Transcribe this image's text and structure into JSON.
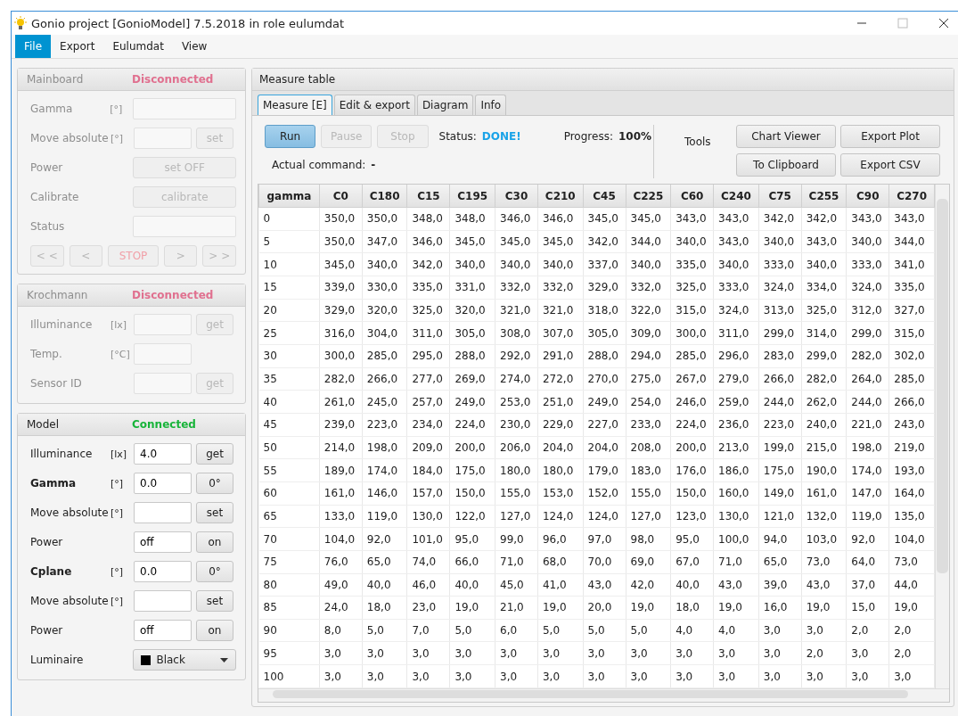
{
  "window": {
    "title": "Gonio project [GonioModel] 7.5.2018 in role eulumdat"
  },
  "menu": [
    {
      "label": "File",
      "selected": true
    },
    {
      "label": "Export",
      "selected": false
    },
    {
      "label": "Eulumdat",
      "selected": false
    },
    {
      "label": "View",
      "selected": false
    }
  ],
  "panels": [
    {
      "title": "Mainboard",
      "status": "Disconnected",
      "connected": false,
      "rows": [
        {
          "kind": "wide_field",
          "label": "Gamma",
          "bold": false,
          "unit": "[°]",
          "value": ""
        },
        {
          "kind": "field_button",
          "label": "Move absolute",
          "bold": false,
          "unit": "[°]",
          "value": "",
          "button": "set"
        },
        {
          "kind": "wide_button",
          "label": "Power",
          "bold": false,
          "button": "set OFF"
        },
        {
          "kind": "wide_button",
          "label": "Calibrate",
          "bold": false,
          "button": "calibrate"
        },
        {
          "kind": "wide_field",
          "label": "Status",
          "bold": false,
          "value": ""
        }
      ],
      "nav_buttons": [
        {
          "label": "< <",
          "kind": "normal"
        },
        {
          "label": "<",
          "kind": "normal"
        },
        {
          "label": "STOP",
          "kind": "stop"
        },
        {
          "label": ">",
          "kind": "normal"
        },
        {
          "label": "> >",
          "kind": "normal"
        }
      ]
    },
    {
      "title": "Krochmann",
      "status": "Disconnected",
      "connected": false,
      "rows": [
        {
          "kind": "field_button",
          "label": "Illuminance",
          "bold": false,
          "unit": "[lx]",
          "value": "",
          "button": "get"
        },
        {
          "kind": "field",
          "label": "Temp.",
          "bold": false,
          "unit": "[°C]",
          "value": ""
        },
        {
          "kind": "field_button",
          "label": "Sensor ID",
          "bold": false,
          "value": "",
          "button": "get"
        }
      ]
    },
    {
      "title": "Model",
      "status": "Connected",
      "connected": true,
      "rows": [
        {
          "kind": "field_button",
          "label": "Illuminance",
          "bold": false,
          "unit": "[lx]",
          "value": "4.0",
          "button": "get"
        },
        {
          "kind": "field_button",
          "label": "Gamma",
          "bold": true,
          "unit": "[°]",
          "value": "0.0",
          "button": "0°"
        },
        {
          "kind": "field_button",
          "label": "Move absolute",
          "bold": false,
          "unit": "[°]",
          "value": "",
          "button": "set"
        },
        {
          "kind": "field_button",
          "label": "Power",
          "bold": false,
          "value": "off",
          "button": "on"
        },
        {
          "kind": "field_button",
          "label": "Cplane",
          "bold": true,
          "unit": "[°]",
          "value": "0.0",
          "button": "0°"
        },
        {
          "kind": "field_button",
          "label": "Move absolute",
          "bold": false,
          "unit": "[°]",
          "value": "",
          "button": "set"
        },
        {
          "kind": "field_button",
          "label": "Power",
          "bold": false,
          "value": "off",
          "button": "on"
        },
        {
          "kind": "select",
          "label": "Luminaire",
          "bold": false,
          "value": "Black",
          "color": "#000000"
        }
      ]
    }
  ],
  "measure": {
    "title": "Measure table",
    "tabs": [
      {
        "label": "Measure [E]",
        "selected": true
      },
      {
        "label": "Edit & export",
        "selected": false
      },
      {
        "label": "Diagram",
        "selected": false
      },
      {
        "label": "Info",
        "selected": false
      }
    ],
    "controls": [
      {
        "label": "Run",
        "disabled": false
      },
      {
        "label": "Pause",
        "disabled": true
      },
      {
        "label": "Stop",
        "disabled": true
      }
    ],
    "status_label": "Status:",
    "status": "DONE!",
    "progress_label": "Progress:",
    "progress": "100%",
    "command_label": "Actual command:",
    "command": "-",
    "tools_label": "Tools",
    "tools": [
      "Chart Viewer",
      "Export Plot",
      "To Clipboard",
      "Export CSV"
    ],
    "columns": [
      "gamma",
      "C0",
      "C180",
      "C15",
      "C195",
      "C30",
      "C210",
      "C45",
      "C225",
      "C60",
      "C240",
      "C75",
      "C255",
      "C90",
      "C270"
    ],
    "rows": [
      [
        "0",
        "350,0",
        "350,0",
        "348,0",
        "348,0",
        "346,0",
        "346,0",
        "345,0",
        "345,0",
        "343,0",
        "343,0",
        "342,0",
        "342,0",
        "343,0",
        "343,0"
      ],
      [
        "5",
        "350,0",
        "347,0",
        "346,0",
        "345,0",
        "345,0",
        "345,0",
        "342,0",
        "344,0",
        "340,0",
        "343,0",
        "340,0",
        "343,0",
        "340,0",
        "344,0"
      ],
      [
        "10",
        "345,0",
        "340,0",
        "342,0",
        "340,0",
        "340,0",
        "340,0",
        "337,0",
        "340,0",
        "335,0",
        "340,0",
        "333,0",
        "340,0",
        "333,0",
        "341,0"
      ],
      [
        "15",
        "339,0",
        "330,0",
        "335,0",
        "331,0",
        "332,0",
        "332,0",
        "329,0",
        "332,0",
        "325,0",
        "333,0",
        "324,0",
        "334,0",
        "324,0",
        "335,0"
      ],
      [
        "20",
        "329,0",
        "320,0",
        "325,0",
        "320,0",
        "321,0",
        "321,0",
        "318,0",
        "322,0",
        "315,0",
        "324,0",
        "313,0",
        "325,0",
        "312,0",
        "327,0"
      ],
      [
        "25",
        "316,0",
        "304,0",
        "311,0",
        "305,0",
        "308,0",
        "307,0",
        "305,0",
        "309,0",
        "300,0",
        "311,0",
        "299,0",
        "314,0",
        "299,0",
        "315,0"
      ],
      [
        "30",
        "300,0",
        "285,0",
        "295,0",
        "288,0",
        "292,0",
        "291,0",
        "288,0",
        "294,0",
        "285,0",
        "296,0",
        "283,0",
        "299,0",
        "282,0",
        "302,0"
      ],
      [
        "35",
        "282,0",
        "266,0",
        "277,0",
        "269,0",
        "274,0",
        "272,0",
        "270,0",
        "275,0",
        "267,0",
        "279,0",
        "266,0",
        "282,0",
        "264,0",
        "285,0"
      ],
      [
        "40",
        "261,0",
        "245,0",
        "257,0",
        "249,0",
        "253,0",
        "251,0",
        "249,0",
        "254,0",
        "246,0",
        "259,0",
        "244,0",
        "262,0",
        "244,0",
        "266,0"
      ],
      [
        "45",
        "239,0",
        "223,0",
        "234,0",
        "224,0",
        "230,0",
        "229,0",
        "227,0",
        "233,0",
        "224,0",
        "236,0",
        "223,0",
        "240,0",
        "221,0",
        "243,0"
      ],
      [
        "50",
        "214,0",
        "198,0",
        "209,0",
        "200,0",
        "206,0",
        "204,0",
        "204,0",
        "208,0",
        "200,0",
        "213,0",
        "199,0",
        "215,0",
        "198,0",
        "219,0"
      ],
      [
        "55",
        "189,0",
        "174,0",
        "184,0",
        "175,0",
        "180,0",
        "180,0",
        "179,0",
        "183,0",
        "176,0",
        "186,0",
        "175,0",
        "190,0",
        "174,0",
        "193,0"
      ],
      [
        "60",
        "161,0",
        "146,0",
        "157,0",
        "150,0",
        "155,0",
        "153,0",
        "152,0",
        "155,0",
        "150,0",
        "160,0",
        "149,0",
        "161,0",
        "147,0",
        "164,0"
      ],
      [
        "65",
        "133,0",
        "119,0",
        "130,0",
        "122,0",
        "127,0",
        "124,0",
        "124,0",
        "127,0",
        "123,0",
        "130,0",
        "121,0",
        "132,0",
        "119,0",
        "135,0"
      ],
      [
        "70",
        "104,0",
        "92,0",
        "101,0",
        "95,0",
        "99,0",
        "96,0",
        "97,0",
        "98,0",
        "95,0",
        "100,0",
        "94,0",
        "103,0",
        "92,0",
        "104,0"
      ],
      [
        "75",
        "76,0",
        "65,0",
        "74,0",
        "66,0",
        "71,0",
        "68,0",
        "70,0",
        "69,0",
        "67,0",
        "71,0",
        "65,0",
        "73,0",
        "64,0",
        "73,0"
      ],
      [
        "80",
        "49,0",
        "40,0",
        "46,0",
        "40,0",
        "45,0",
        "41,0",
        "43,0",
        "42,0",
        "40,0",
        "43,0",
        "39,0",
        "43,0",
        "37,0",
        "44,0"
      ],
      [
        "85",
        "24,0",
        "18,0",
        "23,0",
        "19,0",
        "21,0",
        "19,0",
        "20,0",
        "19,0",
        "18,0",
        "19,0",
        "16,0",
        "19,0",
        "15,0",
        "19,0"
      ],
      [
        "90",
        "8,0",
        "5,0",
        "7,0",
        "5,0",
        "6,0",
        "5,0",
        "5,0",
        "5,0",
        "4,0",
        "4,0",
        "3,0",
        "3,0",
        "2,0",
        "2,0"
      ],
      [
        "95",
        "3,0",
        "3,0",
        "3,0",
        "3,0",
        "3,0",
        "3,0",
        "3,0",
        "3,0",
        "3,0",
        "3,0",
        "3,0",
        "2,0",
        "3,0",
        "2,0"
      ],
      [
        "100",
        "3,0",
        "3,0",
        "3,0",
        "3,0",
        "3,0",
        "3,0",
        "3,0",
        "3,0",
        "3,0",
        "3,0",
        "3,0",
        "3,0",
        "3,0",
        "3,0"
      ]
    ]
  }
}
